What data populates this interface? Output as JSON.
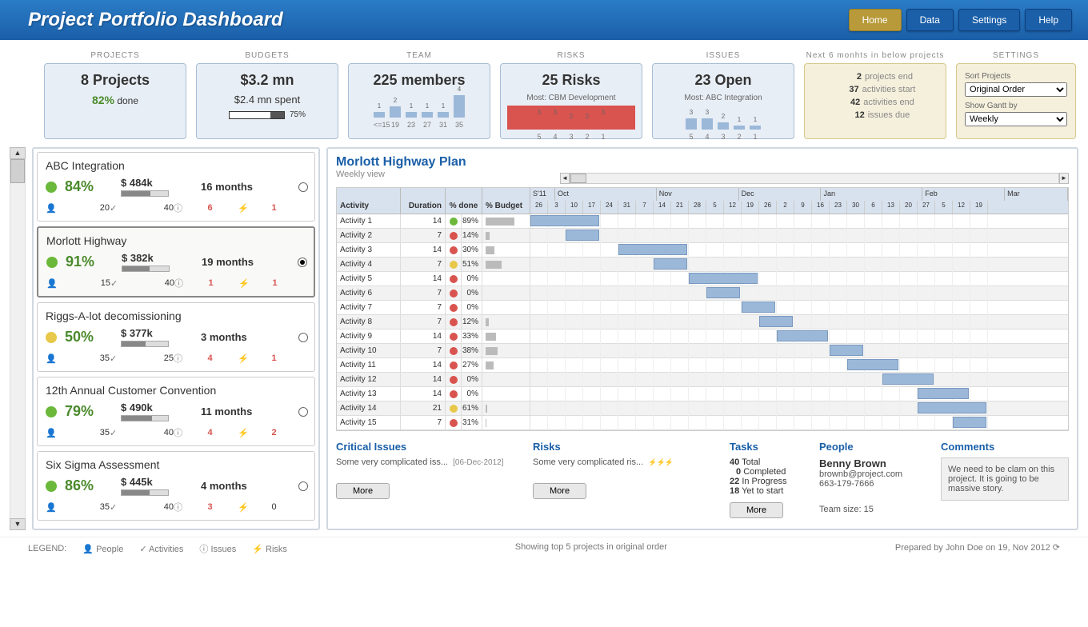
{
  "header": {
    "title": "Project Portfolio Dashboard"
  },
  "nav": {
    "home": "Home",
    "data": "Data",
    "settings": "Settings",
    "help": "Help"
  },
  "tiles": {
    "projects": {
      "label": "PROJECTS",
      "big": "8 Projects",
      "pct": "82%",
      "done": " done"
    },
    "budgets": {
      "label": "BUDGETS",
      "big": "$3.2 mn",
      "sub": "$2.4 mn spent",
      "barpct": "75%"
    },
    "team": {
      "label": "TEAM",
      "big": "225 members",
      "bars": [
        {
          "v": 1,
          "l": "<=15"
        },
        {
          "v": 2,
          "l": "19"
        },
        {
          "v": 1,
          "l": "23"
        },
        {
          "v": 1,
          "l": "27"
        },
        {
          "v": 1,
          "l": "31"
        },
        {
          "v": 4,
          "l": "35"
        }
      ]
    },
    "risks": {
      "label": "RISKS",
      "big": "25 Risks",
      "sub": "Most: CBM Development",
      "bars": [
        {
          "v": 3,
          "l": "5"
        },
        {
          "v": 3,
          "l": "4"
        },
        {
          "v": 2,
          "l": "3"
        },
        {
          "v": 2,
          "l": "2"
        },
        {
          "v": 3,
          "l": "1"
        }
      ]
    },
    "issues": {
      "label": "ISSUES",
      "big": "23 Open",
      "sub": "Most: ABC Integration",
      "bars": [
        {
          "v": 3,
          "l": "5"
        },
        {
          "v": 3,
          "l": "4"
        },
        {
          "v": 2,
          "l": "3"
        },
        {
          "v": 1,
          "l": "2"
        },
        {
          "v": 1,
          "l": "1"
        }
      ]
    },
    "info": {
      "label": "Next 6 monhts in below projects",
      "lines": [
        {
          "n": "2",
          "t": "projects end"
        },
        {
          "n": "37",
          "t": "activities start"
        },
        {
          "n": "42",
          "t": "activities end"
        },
        {
          "n": "12",
          "t": "issues due"
        }
      ]
    },
    "settings": {
      "label": "SETTINGS",
      "sort_label": "Sort Projects",
      "sort_val": "Original Order",
      "gantt_label": "Show Gantt by",
      "gantt_val": "Weekly"
    }
  },
  "projects": [
    {
      "name": "ABC Integration",
      "dot": "green",
      "pct": "84%",
      "budget": "$ 484k",
      "bar": 62,
      "months": "16 months",
      "people": "20",
      "acts": "40",
      "issues": "6",
      "risks": "1",
      "sel": false
    },
    {
      "name": "Morlott Highway",
      "dot": "green",
      "pct": "91%",
      "budget": "$ 382k",
      "bar": 58,
      "months": "19 months",
      "people": "15",
      "acts": "40",
      "issues": "1",
      "risks": "1",
      "sel": true
    },
    {
      "name": "Riggs-A-lot decomissioning",
      "dot": "yellow",
      "pct": "50%",
      "budget": "$ 377k",
      "bar": 52,
      "months": "3 months",
      "people": "35",
      "acts": "25",
      "issues": "4",
      "risks": "1",
      "sel": false
    },
    {
      "name": "12th Annual Customer Convention",
      "dot": "green",
      "pct": "79%",
      "budget": "$ 490k",
      "bar": 65,
      "months": "11 months",
      "people": "35",
      "acts": "40",
      "issues": "4",
      "risks": "2",
      "sel": false
    },
    {
      "name": "Six Sigma Assessment",
      "dot": "green",
      "pct": "86%",
      "budget": "$ 445k",
      "bar": 60,
      "months": "4 months",
      "people": "35",
      "acts": "40",
      "issues": "3",
      "risks": "0",
      "sel": false
    }
  ],
  "detail": {
    "title": "Morlott Highway Plan",
    "subtitle": "Weekly view",
    "cols": {
      "activity": "Activity",
      "duration": "Duration",
      "pctdone": "% done",
      "pctbudget": "% Budget"
    },
    "months": [
      "S'11",
      "Oct",
      "Nov",
      "Dec",
      "Jan",
      "Feb",
      "Mar"
    ],
    "weeks": [
      "26",
      "3",
      "10",
      "17",
      "24",
      "31",
      "7",
      "14",
      "21",
      "28",
      "5",
      "12",
      "19",
      "26",
      "2",
      "9",
      "16",
      "23",
      "30",
      "6",
      "13",
      "20",
      "27",
      "5",
      "12",
      "19"
    ],
    "rows": [
      {
        "a": "Activity 1",
        "d": "14",
        "s": "green",
        "p": "89%",
        "bw": 70,
        "gs": 0,
        "gw": 4
      },
      {
        "a": "Activity 2",
        "d": "7",
        "s": "red",
        "p": "14%",
        "bw": 10,
        "gs": 2,
        "gw": 2
      },
      {
        "a": "Activity 3",
        "d": "14",
        "s": "red",
        "p": "30%",
        "bw": 22,
        "gs": 5,
        "gw": 4
      },
      {
        "a": "Activity 4",
        "d": "7",
        "s": "yellow",
        "p": "51%",
        "bw": 40,
        "gs": 7,
        "gw": 2
      },
      {
        "a": "Activity 5",
        "d": "14",
        "s": "red",
        "p": "0%",
        "bw": 0,
        "gs": 9,
        "gw": 4
      },
      {
        "a": "Activity 6",
        "d": "7",
        "s": "red",
        "p": "0%",
        "bw": 0,
        "gs": 10,
        "gw": 2
      },
      {
        "a": "Activity 7",
        "d": "7",
        "s": "red",
        "p": "0%",
        "bw": 0,
        "gs": 12,
        "gw": 2
      },
      {
        "a": "Activity 8",
        "d": "7",
        "s": "red",
        "p": "12%",
        "bw": 8,
        "gs": 13,
        "gw": 2
      },
      {
        "a": "Activity 9",
        "d": "14",
        "s": "red",
        "p": "33%",
        "bw": 25,
        "gs": 14,
        "gw": 3
      },
      {
        "a": "Activity 10",
        "d": "7",
        "s": "red",
        "p": "38%",
        "bw": 30,
        "gs": 17,
        "gw": 2
      },
      {
        "a": "Activity 11",
        "d": "14",
        "s": "red",
        "p": "27%",
        "bw": 20,
        "gs": 18,
        "gw": 3
      },
      {
        "a": "Activity 12",
        "d": "14",
        "s": "red",
        "p": "0%",
        "bw": 0,
        "gs": 20,
        "gw": 3
      },
      {
        "a": "Activity 13",
        "d": "14",
        "s": "red",
        "p": "0%",
        "bw": 0,
        "gs": 22,
        "gw": 3
      },
      {
        "a": "Activity 14",
        "d": "21",
        "s": "yellow",
        "p": "61%",
        "bw": 3,
        "gs": 22,
        "gw": 4
      },
      {
        "a": "Activity 15",
        "d": "7",
        "s": "red",
        "p": "31%",
        "bw": 2,
        "gs": 24,
        "gw": 2
      }
    ]
  },
  "panels": {
    "issues": {
      "title": "Critical Issues",
      "text": "Some very complicated iss...",
      "date": "[06-Dec-2012]",
      "more": "More"
    },
    "risks": {
      "title": "Risks",
      "text": "Some very complicated ris...",
      "spark": "✓ ✓ ✓",
      "more": "More"
    },
    "tasks": {
      "title": "Tasks",
      "total_n": "40",
      "total_t": "Total",
      "comp_n": "0",
      "comp_t": "Completed",
      "prog_n": "22",
      "prog_t": "In Progress",
      "yet_n": "18",
      "yet_t": "Yet to start",
      "more": "More"
    },
    "people": {
      "title": "People",
      "name": "Benny Brown",
      "email": "brownb@project.com",
      "phone": "663-179-7666",
      "team": "Team size: 15"
    },
    "comments": {
      "title": "Comments",
      "text": "We need to be clam on this project. It is going to be massive story."
    }
  },
  "footer": {
    "legend": "LEGEND:",
    "people": "People",
    "activities": "Activities",
    "issues": "Issues",
    "risks": "Risks",
    "mid": "Showing top 5 projects in original order",
    "right": "Prepared by John Doe on 19, Nov 2012"
  }
}
